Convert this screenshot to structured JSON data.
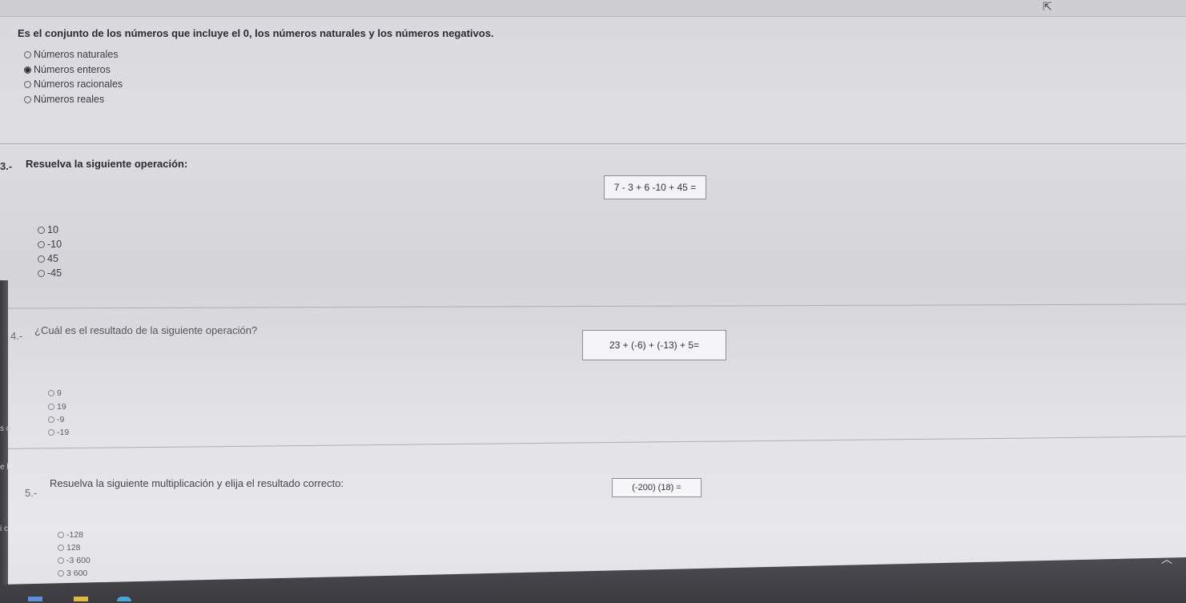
{
  "q2": {
    "question": "Es el conjunto de los números que incluye el 0, los números naturales y los números negativos.",
    "options": [
      "Números naturales",
      "Números enteros",
      "Números racionales",
      "Números reales"
    ],
    "selected_index": 1
  },
  "q3": {
    "number": "3.-",
    "question": "Resuelva la siguiente operación:",
    "expression": "7 - 3 + 6 -10 + 45 =",
    "options": [
      "10",
      "-10",
      "45",
      "-45"
    ]
  },
  "q4": {
    "number": "4.-",
    "question": "¿Cuál es el resultado de la siguiente operación?",
    "expression": "23 + (-6) + (-13) + 5=",
    "options": [
      "9",
      "19",
      "-9",
      "-19"
    ]
  },
  "q5": {
    "number": "5.-",
    "question": "Resuelva la siguiente multiplicación y elija el resultado correcto:",
    "expression": "(-200) (18) =",
    "options": [
      "-128",
      "128",
      "-3 600",
      "3 600"
    ]
  },
  "side_labels": [
    "s o",
    "e l",
    "i c"
  ],
  "colors": {
    "background": "#d7d6da",
    "divider": "#aeadb2",
    "taskbar": "#3a3a3f"
  },
  "icons": [
    "cursor-arrow-icon",
    "chevron-up-icon"
  ]
}
